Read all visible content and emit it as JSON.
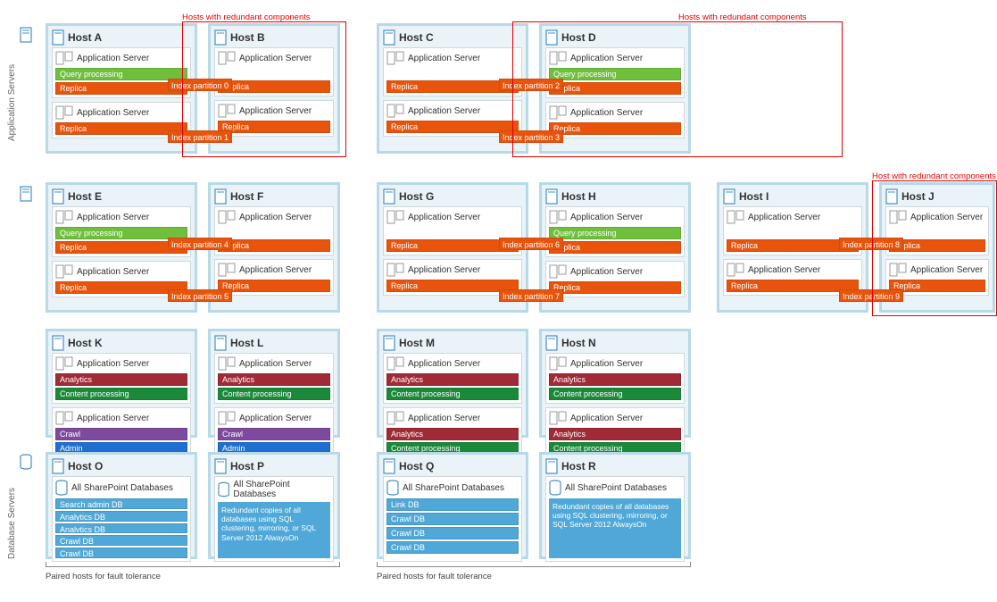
{
  "tier_labels": {
    "app": "Application Servers",
    "db": "Database Servers"
  },
  "as_title": "Application Server",
  "db_title": "All SharePoint Databases",
  "comps": {
    "query": "Query processing",
    "replica": "Replica",
    "analytics": "Analytics",
    "content": "Content processing",
    "crawl": "Crawl",
    "admin": "Admin"
  },
  "index": {
    "0": "Index partition 0",
    "1": "Index partition 1",
    "2": "Index partition 2",
    "3": "Index partition 3",
    "4": "Index partition 4",
    "5": "Index partition 5",
    "6": "Index partition 6",
    "7": "Index partition 7",
    "8": "Index partition 8",
    "9": "Index partition 9"
  },
  "hosts": {
    "A": "Host A",
    "B": "Host B",
    "C": "Host C",
    "D": "Host D",
    "E": "Host E",
    "F": "Host F",
    "G": "Host G",
    "H": "Host H",
    "I": "Host I",
    "J": "Host J",
    "K": "Host K",
    "L": "Host L",
    "M": "Host M",
    "N": "Host N",
    "O": "Host O",
    "P": "Host P",
    "Q": "Host Q",
    "R": "Host R"
  },
  "dbs": {
    "O": [
      "Search admin DB",
      "Analytics DB",
      "Analytics DB",
      "Crawl DB",
      "Crawl DB"
    ],
    "Q": [
      "Link DB",
      "Crawl DB",
      "Crawl DB",
      "Crawl DB"
    ]
  },
  "db_note": "Redundant copies of all databases using SQL clustering, mirroring, or SQL Server 2012 AlwaysOn",
  "labels": {
    "redundant_plural": "Hosts with redundant components",
    "redundant_single": "Host with redundant components",
    "paired": "Paired hosts for fault tolerance"
  }
}
